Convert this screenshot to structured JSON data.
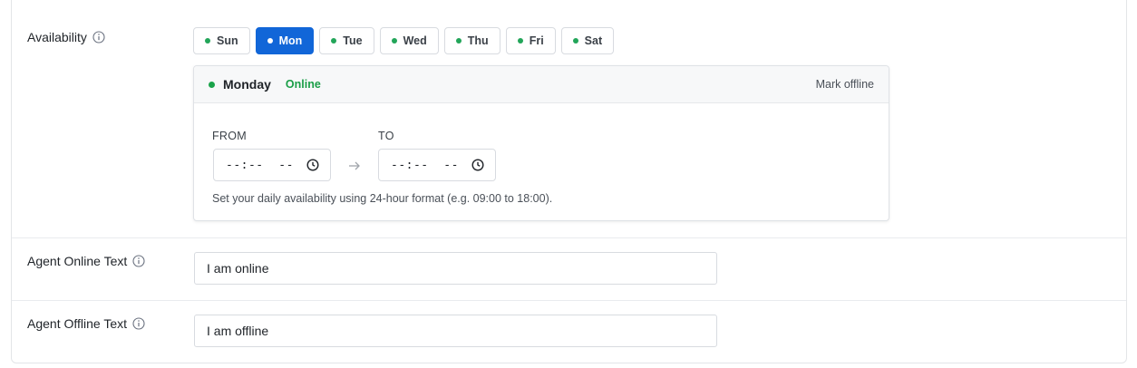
{
  "availability": {
    "label": "Availability",
    "days": [
      {
        "label": "Sun",
        "active": false
      },
      {
        "label": "Mon",
        "active": true
      },
      {
        "label": "Tue",
        "active": false
      },
      {
        "label": "Wed",
        "active": false
      },
      {
        "label": "Thu",
        "active": false
      },
      {
        "label": "Fri",
        "active": false
      },
      {
        "label": "Sat",
        "active": false
      }
    ],
    "panel": {
      "day_name": "Monday",
      "status": "Online",
      "mark_offline": "Mark offline",
      "from_label": "FROM",
      "to_label": "TO",
      "from_value": "--:--  --",
      "to_value": "--:--  --",
      "hint": "Set your daily availability using 24-hour format (e.g. 09:00 to 18:00)."
    }
  },
  "agent_online": {
    "label": "Agent Online Text",
    "value": "I am online"
  },
  "agent_offline": {
    "label": "Agent Offline Text",
    "value": "I am offline"
  },
  "colors": {
    "accent": "#1166d8",
    "online_green": "#1a9e47"
  },
  "icons": {
    "info": "info-icon",
    "clock": "clock-icon",
    "arrow": "arrow-right-icon"
  }
}
